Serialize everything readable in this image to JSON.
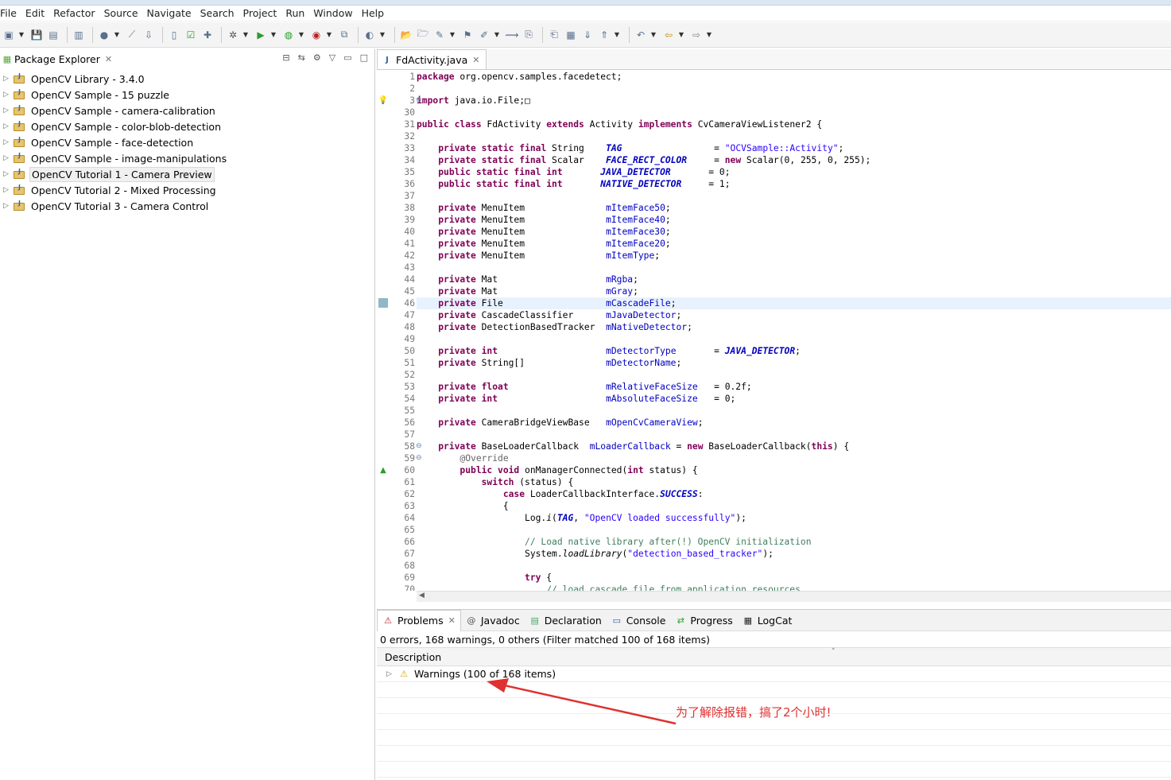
{
  "menu": [
    "File",
    "Edit",
    "Refactor",
    "Source",
    "Navigate",
    "Search",
    "Project",
    "Run",
    "Window",
    "Help"
  ],
  "toolbar_icons": [
    "new-icon",
    "save-icon",
    "save-all-icon",
    "binary-icon",
    "profile-icon",
    "link-icon",
    "android-sdk-icon",
    "avd-icon",
    "checkbox-icon",
    "new-android-icon",
    "debug-icon",
    "run-icon",
    "run-external-icon",
    "coverage-icon",
    "new-java-project-icon",
    "new-class-icon",
    "open-folder-icon",
    "open-type-icon",
    "search-icon",
    "annotation-icon",
    "pen-icon",
    "link-editor-icon",
    "copy-icon",
    "paste-icon",
    "outline-icon",
    "next-annotation-icon",
    "prev-annotation-icon",
    "last-edit-icon",
    "back-icon",
    "forward-icon"
  ],
  "explorer": {
    "title": "Package Explorer",
    "items": [
      {
        "label": "OpenCV Library - 3.4.0",
        "selected": false
      },
      {
        "label": "OpenCV Sample - 15 puzzle",
        "selected": false
      },
      {
        "label": "OpenCV Sample - camera-calibration",
        "selected": false
      },
      {
        "label": "OpenCV Sample - color-blob-detection",
        "selected": false
      },
      {
        "label": "OpenCV Sample - face-detection",
        "selected": false
      },
      {
        "label": "OpenCV Sample - image-manipulations",
        "selected": false
      },
      {
        "label": "OpenCV Tutorial 1 - Camera Preview",
        "selected": true
      },
      {
        "label": "OpenCV Tutorial 2 - Mixed Processing",
        "selected": false
      },
      {
        "label": "OpenCV Tutorial 3 - Camera Control",
        "selected": false
      }
    ]
  },
  "editor": {
    "tab_label": "FdActivity.java",
    "highlighted_line": "46",
    "lines": [
      {
        "n": "1",
        "t": [
          {
            "k": "kw",
            "v": "package"
          },
          {
            "k": "",
            "v": " org.opencv.samples.facedetect;"
          }
        ]
      },
      {
        "n": "2",
        "t": []
      },
      {
        "n": "3",
        "fold": "plus",
        "marker": "warning-bulb",
        "t": [
          {
            "k": "kw",
            "v": "import"
          },
          {
            "k": "",
            "v": " java.io.File;"
          },
          {
            "k": "",
            "v": "□"
          }
        ]
      },
      {
        "n": "30",
        "t": []
      },
      {
        "n": "31",
        "t": [
          {
            "k": "kw",
            "v": "public class"
          },
          {
            "k": "",
            "v": " FdActivity "
          },
          {
            "k": "kw",
            "v": "extends"
          },
          {
            "k": "",
            "v": " Activity "
          },
          {
            "k": "kw",
            "v": "implements"
          },
          {
            "k": "",
            "v": " CvCameraViewListener2 {"
          }
        ]
      },
      {
        "n": "32",
        "t": []
      },
      {
        "n": "33",
        "t": [
          {
            "k": "",
            "v": "    "
          },
          {
            "k": "kw",
            "v": "private static final"
          },
          {
            "k": "",
            "v": " String    "
          },
          {
            "k": "sfld",
            "v": "TAG"
          },
          {
            "k": "",
            "v": "                 = "
          },
          {
            "k": "str",
            "v": "\"OCVSample::Activity\""
          },
          {
            "k": "",
            "v": ";"
          }
        ]
      },
      {
        "n": "34",
        "t": [
          {
            "k": "",
            "v": "    "
          },
          {
            "k": "kw",
            "v": "private static final"
          },
          {
            "k": "",
            "v": " Scalar    "
          },
          {
            "k": "sfld",
            "v": "FACE_RECT_COLOR"
          },
          {
            "k": "",
            "v": "     = "
          },
          {
            "k": "kw",
            "v": "new"
          },
          {
            "k": "",
            "v": " Scalar(0, 255, 0, 255);"
          }
        ]
      },
      {
        "n": "35",
        "t": [
          {
            "k": "",
            "v": "    "
          },
          {
            "k": "kw",
            "v": "public static final int"
          },
          {
            "k": "",
            "v": "       "
          },
          {
            "k": "sfld",
            "v": "JAVA_DETECTOR"
          },
          {
            "k": "",
            "v": "       = 0;"
          }
        ]
      },
      {
        "n": "36",
        "t": [
          {
            "k": "",
            "v": "    "
          },
          {
            "k": "kw",
            "v": "public static final int"
          },
          {
            "k": "",
            "v": "       "
          },
          {
            "k": "sfld",
            "v": "NATIVE_DETECTOR"
          },
          {
            "k": "",
            "v": "     = 1;"
          }
        ]
      },
      {
        "n": "37",
        "t": []
      },
      {
        "n": "38",
        "t": [
          {
            "k": "",
            "v": "    "
          },
          {
            "k": "kw",
            "v": "private"
          },
          {
            "k": "",
            "v": " MenuItem               "
          },
          {
            "k": "fld",
            "v": "mItemFace50"
          },
          {
            "k": "",
            "v": ";"
          }
        ]
      },
      {
        "n": "39",
        "t": [
          {
            "k": "",
            "v": "    "
          },
          {
            "k": "kw",
            "v": "private"
          },
          {
            "k": "",
            "v": " MenuItem               "
          },
          {
            "k": "fld",
            "v": "mItemFace40"
          },
          {
            "k": "",
            "v": ";"
          }
        ]
      },
      {
        "n": "40",
        "t": [
          {
            "k": "",
            "v": "    "
          },
          {
            "k": "kw",
            "v": "private"
          },
          {
            "k": "",
            "v": " MenuItem               "
          },
          {
            "k": "fld",
            "v": "mItemFace30"
          },
          {
            "k": "",
            "v": ";"
          }
        ]
      },
      {
        "n": "41",
        "t": [
          {
            "k": "",
            "v": "    "
          },
          {
            "k": "kw",
            "v": "private"
          },
          {
            "k": "",
            "v": " MenuItem               "
          },
          {
            "k": "fld",
            "v": "mItemFace20"
          },
          {
            "k": "",
            "v": ";"
          }
        ]
      },
      {
        "n": "42",
        "t": [
          {
            "k": "",
            "v": "    "
          },
          {
            "k": "kw",
            "v": "private"
          },
          {
            "k": "",
            "v": " MenuItem               "
          },
          {
            "k": "fld",
            "v": "mItemType"
          },
          {
            "k": "",
            "v": ";"
          }
        ]
      },
      {
        "n": "43",
        "t": []
      },
      {
        "n": "44",
        "t": [
          {
            "k": "",
            "v": "    "
          },
          {
            "k": "kw",
            "v": "private"
          },
          {
            "k": "",
            "v": " Mat                    "
          },
          {
            "k": "fld",
            "v": "mRgba"
          },
          {
            "k": "",
            "v": ";"
          }
        ]
      },
      {
        "n": "45",
        "t": [
          {
            "k": "",
            "v": "    "
          },
          {
            "k": "kw",
            "v": "private"
          },
          {
            "k": "",
            "v": " Mat                    "
          },
          {
            "k": "fld",
            "v": "mGray"
          },
          {
            "k": "",
            "v": ";"
          }
        ]
      },
      {
        "n": "46",
        "marker": "occurrence",
        "t": [
          {
            "k": "",
            "v": "    "
          },
          {
            "k": "kw",
            "v": "private"
          },
          {
            "k": "",
            "v": " File                   "
          },
          {
            "k": "fld",
            "v": "mCascadeFile"
          },
          {
            "k": "",
            "v": ";"
          }
        ]
      },
      {
        "n": "47",
        "t": [
          {
            "k": "",
            "v": "    "
          },
          {
            "k": "kw",
            "v": "private"
          },
          {
            "k": "",
            "v": " CascadeClassifier      "
          },
          {
            "k": "fld",
            "v": "mJavaDetector"
          },
          {
            "k": "",
            "v": ";"
          }
        ]
      },
      {
        "n": "48",
        "t": [
          {
            "k": "",
            "v": "    "
          },
          {
            "k": "kw",
            "v": "private"
          },
          {
            "k": "",
            "v": " DetectionBasedTracker  "
          },
          {
            "k": "fld",
            "v": "mNativeDetector"
          },
          {
            "k": "",
            "v": ";"
          }
        ]
      },
      {
        "n": "49",
        "t": []
      },
      {
        "n": "50",
        "t": [
          {
            "k": "",
            "v": "    "
          },
          {
            "k": "kw",
            "v": "private int"
          },
          {
            "k": "",
            "v": "                    "
          },
          {
            "k": "fld",
            "v": "mDetectorType"
          },
          {
            "k": "",
            "v": "       = "
          },
          {
            "k": "sfld",
            "v": "JAVA_DETECTOR"
          },
          {
            "k": "",
            "v": ";"
          }
        ]
      },
      {
        "n": "51",
        "t": [
          {
            "k": "",
            "v": "    "
          },
          {
            "k": "kw",
            "v": "private"
          },
          {
            "k": "",
            "v": " String[]               "
          },
          {
            "k": "fld",
            "v": "mDetectorName"
          },
          {
            "k": "",
            "v": ";"
          }
        ]
      },
      {
        "n": "52",
        "t": []
      },
      {
        "n": "53",
        "t": [
          {
            "k": "",
            "v": "    "
          },
          {
            "k": "kw",
            "v": "private float"
          },
          {
            "k": "",
            "v": "                  "
          },
          {
            "k": "fld",
            "v": "mRelativeFaceSize"
          },
          {
            "k": "",
            "v": "   = 0.2f;"
          }
        ]
      },
      {
        "n": "54",
        "t": [
          {
            "k": "",
            "v": "    "
          },
          {
            "k": "kw",
            "v": "private int"
          },
          {
            "k": "",
            "v": "                    "
          },
          {
            "k": "fld",
            "v": "mAbsoluteFaceSize"
          },
          {
            "k": "",
            "v": "   = 0;"
          }
        ]
      },
      {
        "n": "55",
        "t": []
      },
      {
        "n": "56",
        "t": [
          {
            "k": "",
            "v": "    "
          },
          {
            "k": "kw",
            "v": "private"
          },
          {
            "k": "",
            "v": " CameraBridgeViewBase   "
          },
          {
            "k": "fld",
            "v": "mOpenCvCameraView"
          },
          {
            "k": "",
            "v": ";"
          }
        ]
      },
      {
        "n": "57",
        "t": []
      },
      {
        "n": "58",
        "fold": "minus",
        "t": [
          {
            "k": "",
            "v": "    "
          },
          {
            "k": "kw",
            "v": "private"
          },
          {
            "k": "",
            "v": " BaseLoaderCallback  "
          },
          {
            "k": "fld",
            "v": "mLoaderCallback"
          },
          {
            "k": "",
            "v": " = "
          },
          {
            "k": "kw",
            "v": "new"
          },
          {
            "k": "",
            "v": " BaseLoaderCallback("
          },
          {
            "k": "kw",
            "v": "this"
          },
          {
            "k": "",
            "v": ") {"
          }
        ]
      },
      {
        "n": "59",
        "fold": "minus",
        "t": [
          {
            "k": "",
            "v": "        "
          },
          {
            "k": "ann",
            "v": "@Override"
          }
        ]
      },
      {
        "n": "60",
        "marker": "override",
        "t": [
          {
            "k": "",
            "v": "        "
          },
          {
            "k": "kw",
            "v": "public void"
          },
          {
            "k": "",
            "v": " onManagerConnected("
          },
          {
            "k": "kw",
            "v": "int"
          },
          {
            "k": "",
            "v": " status) {"
          }
        ]
      },
      {
        "n": "61",
        "t": [
          {
            "k": "",
            "v": "            "
          },
          {
            "k": "kw",
            "v": "switch"
          },
          {
            "k": "",
            "v": " (status) {"
          }
        ]
      },
      {
        "n": "62",
        "t": [
          {
            "k": "",
            "v": "                "
          },
          {
            "k": "kw",
            "v": "case"
          },
          {
            "k": "",
            "v": " LoaderCallbackInterface."
          },
          {
            "k": "sfld",
            "v": "SUCCESS"
          },
          {
            "k": "",
            "v": ":"
          }
        ]
      },
      {
        "n": "63",
        "t": [
          {
            "k": "",
            "v": "                {"
          }
        ]
      },
      {
        "n": "64",
        "t": [
          {
            "k": "",
            "v": "                    Log."
          },
          {
            "k": "ital",
            "v": "i"
          },
          {
            "k": "",
            "v": "("
          },
          {
            "k": "sfld",
            "v": "TAG"
          },
          {
            "k": "",
            "v": ", "
          },
          {
            "k": "str",
            "v": "\"OpenCV loaded successfully\""
          },
          {
            "k": "",
            "v": ");"
          }
        ]
      },
      {
        "n": "65",
        "t": []
      },
      {
        "n": "66",
        "t": [
          {
            "k": "",
            "v": "                    "
          },
          {
            "k": "cmt",
            "v": "// Load native library after(!) OpenCV initialization"
          }
        ]
      },
      {
        "n": "67",
        "t": [
          {
            "k": "",
            "v": "                    System."
          },
          {
            "k": "ital",
            "v": "loadLibrary"
          },
          {
            "k": "",
            "v": "("
          },
          {
            "k": "str",
            "v": "\"detection_based_tracker\""
          },
          {
            "k": "",
            "v": ");"
          }
        ]
      },
      {
        "n": "68",
        "t": []
      },
      {
        "n": "69",
        "t": [
          {
            "k": "",
            "v": "                    "
          },
          {
            "k": "kw",
            "v": "try"
          },
          {
            "k": "",
            "v": " {"
          }
        ]
      },
      {
        "n": "70",
        "t": [
          {
            "k": "",
            "v": "                        "
          },
          {
            "k": "cmt",
            "v": "// load cascade file from application resources"
          }
        ]
      }
    ]
  },
  "bottom": {
    "tabs": [
      {
        "label": "Problems",
        "icon": "problems-icon",
        "active": true
      },
      {
        "label": "Javadoc",
        "icon": "at-icon",
        "active": false
      },
      {
        "label": "Declaration",
        "icon": "declaration-icon",
        "active": false
      },
      {
        "label": "Console",
        "icon": "console-icon",
        "active": false
      },
      {
        "label": "Progress",
        "icon": "progress-icon",
        "active": false
      },
      {
        "label": "LogCat",
        "icon": "logcat-icon",
        "active": false
      }
    ],
    "summary": "0 errors, 168 warnings, 0 others (Filter matched 100 of 168 items)",
    "column_header": "Description",
    "rows": [
      {
        "label": "Warnings (100 of 168 items)"
      }
    ],
    "empty_rows": 7
  },
  "annotation": {
    "text": "为了解除报错，搞了2个小时!",
    "color": "#e03030"
  }
}
